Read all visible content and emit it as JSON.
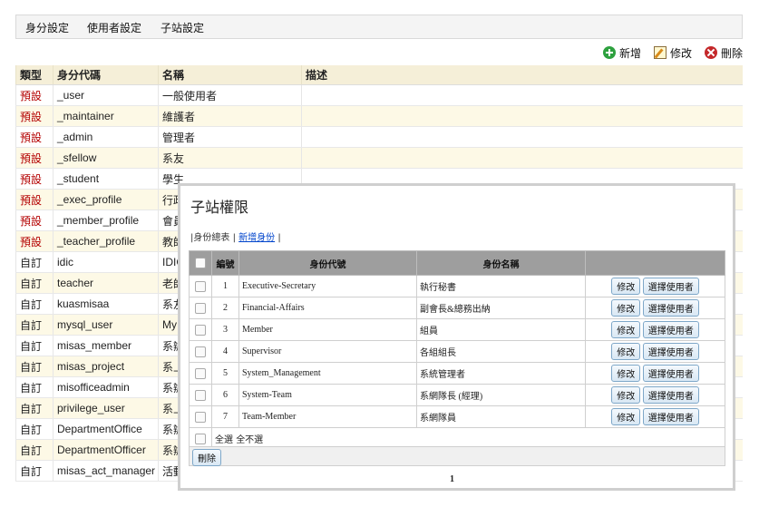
{
  "tabs": [
    "身分設定",
    "使用者設定",
    "子站設定"
  ],
  "toolbar": {
    "add": "新增",
    "edit": "修改",
    "delete": "刪除"
  },
  "main_table": {
    "headers": [
      "類型",
      "身分代碼",
      "名稱",
      "描述"
    ],
    "rows": [
      {
        "type": "預設",
        "code": "_user",
        "name": "一般使用者",
        "desc": ""
      },
      {
        "type": "預設",
        "code": "_maintainer",
        "name": "維護者",
        "desc": ""
      },
      {
        "type": "預設",
        "code": "_admin",
        "name": "管理者",
        "desc": ""
      },
      {
        "type": "預設",
        "code": "_sfellow",
        "name": "系友",
        "desc": ""
      },
      {
        "type": "預設",
        "code": "_student",
        "name": "學生",
        "desc": ""
      },
      {
        "type": "預設",
        "code": "_exec_profile",
        "name": "行政",
        "desc": ""
      },
      {
        "type": "預設",
        "code": "_member_profile",
        "name": "會員",
        "desc": ""
      },
      {
        "type": "預設",
        "code": "_teacher_profile",
        "name": "教師",
        "desc": ""
      },
      {
        "type": "自訂",
        "code": "idic",
        "name": "IDIC",
        "desc": ""
      },
      {
        "type": "自訂",
        "code": "teacher",
        "name": "老師",
        "desc": ""
      },
      {
        "type": "自訂",
        "code": "kuasmisaa",
        "name": "系友",
        "desc": ""
      },
      {
        "type": "自訂",
        "code": "mysql_user",
        "name": "My",
        "desc": ""
      },
      {
        "type": "自訂",
        "code": "misas_member",
        "name": "系辦",
        "desc": ""
      },
      {
        "type": "自訂",
        "code": "misas_project",
        "name": "系上",
        "desc": ""
      },
      {
        "type": "自訂",
        "code": "misofficeadmin",
        "name": "系辦",
        "desc": ""
      },
      {
        "type": "自訂",
        "code": "privilege_user",
        "name": "系上",
        "desc": ""
      },
      {
        "type": "自訂",
        "code": "DepartmentOffice",
        "name": "系辦",
        "desc": ""
      },
      {
        "type": "自訂",
        "code": "DepartmentOfficer",
        "name": "系辦",
        "desc": ""
      },
      {
        "type": "自訂",
        "code": "misas_act_manager",
        "name": "活動",
        "desc": ""
      }
    ]
  },
  "dialog": {
    "title": "子站權限",
    "links": {
      "prefix": "|",
      "list": "身份總表",
      "sep": "|",
      "new": "新增身份",
      "suffix": "|"
    },
    "headers": [
      "",
      "編號",
      "身份代號",
      "身份名稱",
      ""
    ],
    "rows": [
      {
        "no": "1",
        "code": "Executive-Secretary",
        "name": "執行秘書"
      },
      {
        "no": "2",
        "code": "Financial-Affairs",
        "name": "副會長&總務出納"
      },
      {
        "no": "3",
        "code": "Member",
        "name": "組員"
      },
      {
        "no": "4",
        "code": "Supervisor",
        "name": "各組組長"
      },
      {
        "no": "5",
        "code": "System_Management",
        "name": "系統管理者"
      },
      {
        "no": "6",
        "code": "System-Team",
        "name": "系網隊長 (經理)"
      },
      {
        "no": "7",
        "code": "Team-Member",
        "name": "系網隊員"
      }
    ],
    "edit_label": "修改",
    "select_user_label": "選擇使用者",
    "select_all": "全選",
    "select_none": "全不選",
    "delete_label": "刪除",
    "page": "1"
  }
}
